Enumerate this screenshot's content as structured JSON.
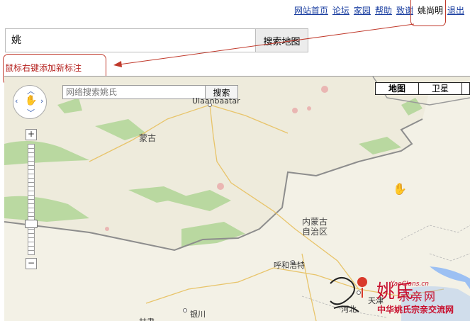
{
  "topnav": {
    "links": [
      "网站首页",
      "论坛",
      "家园",
      "帮助",
      "致谢"
    ],
    "user": "姚尚明",
    "logout": "退出"
  },
  "search": {
    "value": "姚",
    "button": "搜索地图"
  },
  "hint": "鼠标右键添加新标注",
  "map": {
    "net_search_placeholder": "网络搜索姚氏",
    "net_search_button": "搜索",
    "types": {
      "map": "地图",
      "satellite": "卫星"
    },
    "labels": {
      "mongolia": "蒙古",
      "ulaanbaatar": "Ulaanbaatar",
      "inner_mongolia": "内蒙古\n自治区",
      "hohhot": "呼和浩特",
      "tianjin": "天津",
      "hebei": "河北",
      "yinchuan": "银川",
      "gansu": "甘肃"
    },
    "zoom_plus": "+",
    "zoom_minus": "−"
  },
  "watermark": {
    "title": "姚氏",
    "zongqin": "宗亲网",
    "url": "YaoClans.cn",
    "sub": "中华姚氏宗亲交流网"
  }
}
